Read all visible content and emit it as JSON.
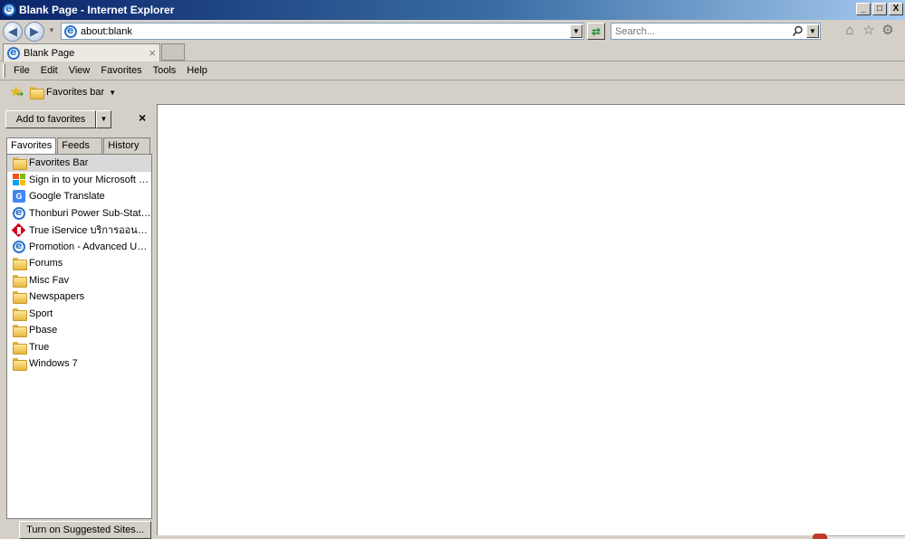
{
  "window": {
    "title": "Blank Page - Internet Explorer",
    "minimize": "_",
    "maximize": "□",
    "close": "X"
  },
  "address": {
    "url": "about:blank",
    "search_placeholder": "Search..."
  },
  "tab": {
    "label": "Blank Page",
    "close": "×"
  },
  "menu": [
    "File",
    "Edit",
    "View",
    "Favorites",
    "Tools",
    "Help"
  ],
  "favorites_bar": {
    "label": "Favorites bar"
  },
  "favorites_pane": {
    "add_button": "Add to favorites",
    "close": "×",
    "tabs": [
      "Favorites",
      "Feeds",
      "History"
    ],
    "items": [
      {
        "label": "Favorites Bar",
        "icon": "folder-icon"
      },
      {
        "label": "Sign in to your Microsoft acc...",
        "icon": "microsoft-icon"
      },
      {
        "label": "Google Translate",
        "icon": "google-translate-icon"
      },
      {
        "label": "Thonburi Power Sub-Station,...",
        "icon": "ie-page-icon"
      },
      {
        "label": "True iService   บริการออนไล...",
        "icon": "true-icon"
      },
      {
        "label": "Promotion - Advanced Unins...",
        "icon": "ie-page-icon"
      },
      {
        "label": "Forums",
        "icon": "folder-icon"
      },
      {
        "label": "Misc Fav",
        "icon": "folder-icon"
      },
      {
        "label": "Newspapers",
        "icon": "folder-icon"
      },
      {
        "label": "Sport",
        "icon": "folder-icon"
      },
      {
        "label": "Pbase",
        "icon": "folder-icon"
      },
      {
        "label": "True",
        "icon": "folder-icon"
      },
      {
        "label": "Windows 7",
        "icon": "folder-icon"
      }
    ],
    "suggest_button": "Turn on Suggested Sites..."
  }
}
